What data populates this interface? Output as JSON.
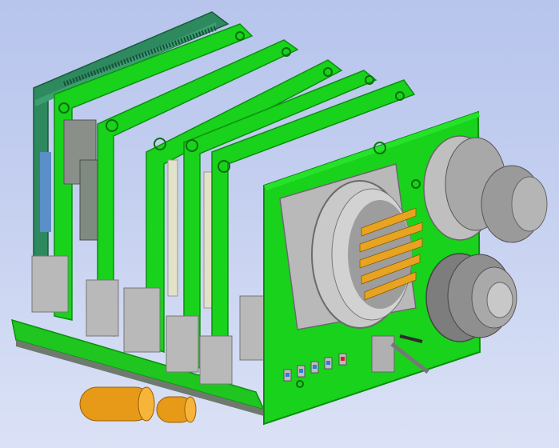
{
  "scene": {
    "background_top": "#b7c4ec",
    "background_bottom": "#dbe2f6",
    "pcb_color": "#19d21b",
    "pcb_edge": "#0c8f10",
    "pcb_dark_color": "#2e8a5e",
    "connector_gray": "#b9b9b9",
    "pin_color": "#e8a420",
    "standoff_color": "#e69a18",
    "board_count": 6,
    "led_colors": [
      "#2b7fd6",
      "#2b7fd6",
      "#2b7fd6",
      "#2b7fd6",
      "#d62020"
    ]
  }
}
